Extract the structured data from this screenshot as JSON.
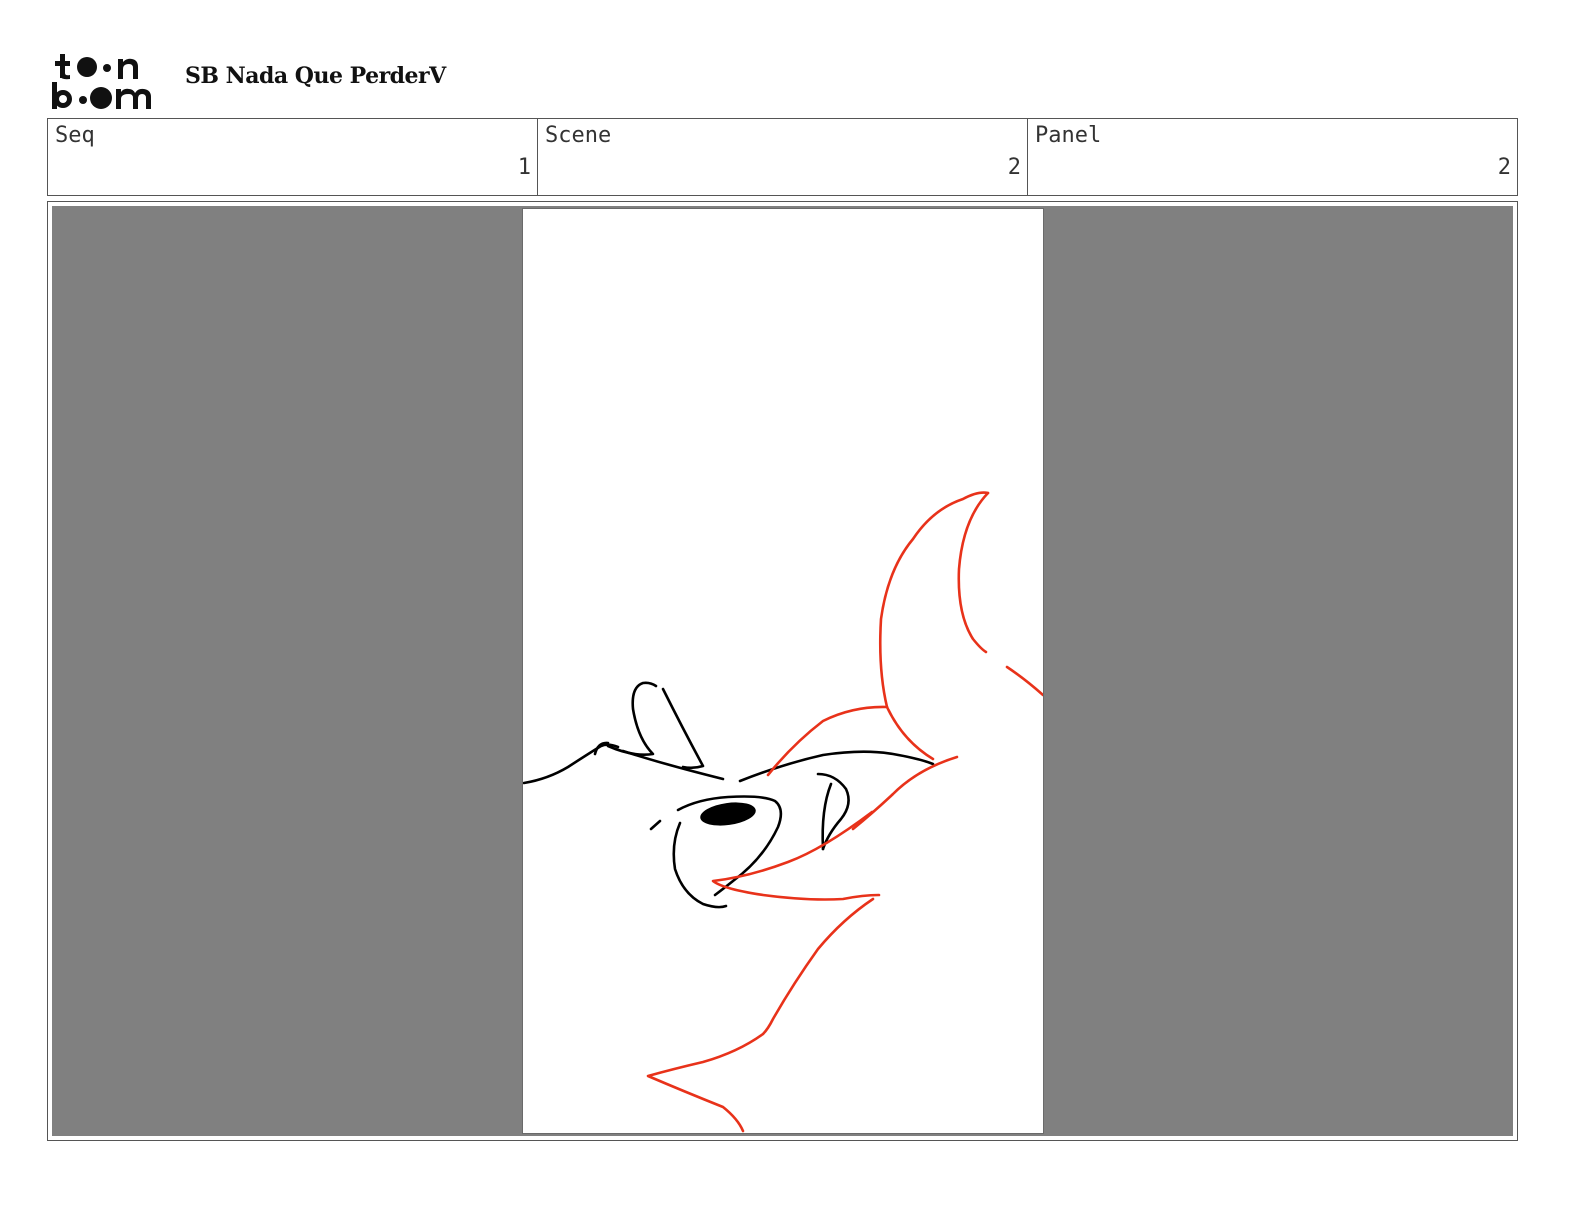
{
  "header": {
    "logo_text": "toon boom",
    "title": "SB Nada Que PerderV"
  },
  "info": {
    "seq": {
      "label": "Seq",
      "value": "1"
    },
    "scene": {
      "label": "Scene",
      "value": "2"
    },
    "panel": {
      "label": "Panel",
      "value": "2"
    }
  },
  "panel_image": {
    "background_color": "#808080",
    "sketch_colors": {
      "outline": "#000000",
      "accent": "#e8321a"
    }
  }
}
